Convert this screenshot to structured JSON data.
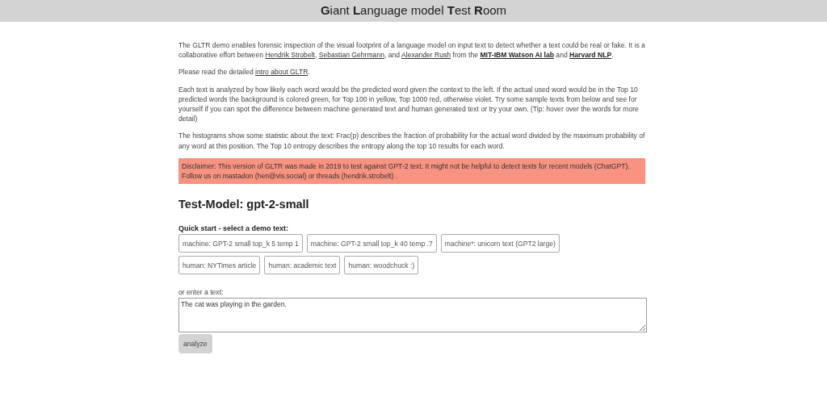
{
  "header": {
    "title": "**G**iant **L**anguage model **T**est **R**oom"
  },
  "paragraphs": [
    {
      "parts": [
        {
          "kind": "text",
          "text": "The GLTR demo enables forensic inspection of the visual footprint of a language model on input text to detect whether a text could be real or fake. It is a collaborative effort between "
        },
        {
          "kind": "link",
          "text": "Hendrik Strobelt"
        },
        {
          "kind": "text",
          "text": ", "
        },
        {
          "kind": "link",
          "text": "Sebastian Gehrmann"
        },
        {
          "kind": "text",
          "text": ", and "
        },
        {
          "kind": "link",
          "text": "Alexander Rush"
        },
        {
          "kind": "text",
          "text": " from the "
        },
        {
          "kind": "bold_link",
          "text": "MIT-IBM Watson AI lab"
        },
        {
          "kind": "text",
          "text": " and "
        },
        {
          "kind": "bold_link",
          "text": "Harvard NLP"
        },
        {
          "kind": "text",
          "text": "."
        }
      ]
    },
    {
      "parts": [
        {
          "kind": "text",
          "text": "Please read the detailed "
        },
        {
          "kind": "link",
          "text": "intro about GLTR"
        },
        {
          "kind": "text",
          "text": "."
        }
      ]
    },
    {
      "parts": [
        {
          "kind": "text",
          "text": "Each text is analyzed by how likely each word would be the predicted word given the context to the left. If the actual used word would be in the Top 10 predicted words the background is colored green, for Top 100 in yellow, Top 1000 red, otherwise violet. Try some sample texts from below and see for yourself if you can spot the difference between machine generated text and human generated text or try your own. (Tip: hover over the words for more detail)"
        }
      ]
    },
    {
      "parts": [
        {
          "kind": "text",
          "text": "The histograms show some statistic about the text: Frac(p) describes the fraction of probability for the actual word divided by the maximum probability of any word at this position. The Top 10 entropy describes the entropy along the top 10 results for each word."
        }
      ]
    }
  ],
  "disclaimer": "Disclaimer: This version of GLTR was made in 2019 to test against GPT-2 text. It might not be helpful to detect texts for recent models (ChatGPT). Follow us on mastadon (hen@vis.social) or threads (hendrik.strobelt) .",
  "model_heading": "Test-Model: gpt-2-small",
  "quick_start": {
    "label": "Quick start - select a demo text:",
    "buttons": [
      [
        "machine: GPT-2 small top_k 5 temp 1",
        "machine: GPT-2 small top_k 40 temp .7",
        "machine*: unicorn text (GPT2 large)"
      ],
      [
        "human: NYTimes article",
        "human: academic text",
        "human: woodchuck :)"
      ]
    ]
  },
  "input": {
    "label": "or enter a text:",
    "value": "The cat was playing in the garden."
  },
  "analyze_button": "analyze"
}
